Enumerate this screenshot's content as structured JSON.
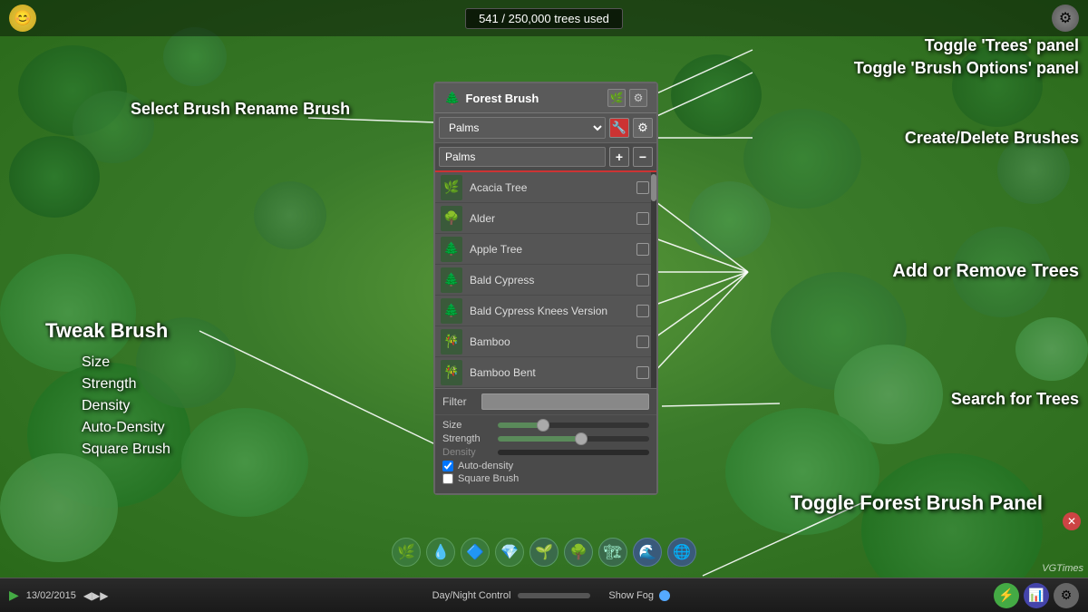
{
  "game": {
    "bg_color": "#3a7a2a",
    "tree_counter": "541 / 250,000 trees used"
  },
  "panel": {
    "title": "Forest Brush",
    "tree_icon": "🌲",
    "settings_icon": "⚙",
    "select_brush_label": "Select Brush",
    "rename_brush_label": "Rename Brush",
    "selected_brush": "Palms",
    "rename_value": "Palms",
    "add_btn": "+",
    "delete_btn": "−",
    "filter_label": "Filter",
    "filter_placeholder": "",
    "tree_list": [
      {
        "name": "Acacia Tree",
        "icon": "🌿",
        "checked": false
      },
      {
        "name": "Alder",
        "icon": "🌳",
        "checked": false
      },
      {
        "name": "Apple Tree",
        "icon": "🌲",
        "checked": false
      },
      {
        "name": "Bald Cypress",
        "icon": "🌲",
        "checked": false
      },
      {
        "name": "Bald Cypress Knees Version",
        "icon": "🌲",
        "checked": false
      },
      {
        "name": "Bamboo",
        "icon": "🎋",
        "checked": false
      },
      {
        "name": "Bamboo Bent",
        "icon": "🎋",
        "checked": false
      }
    ],
    "size_label": "Size",
    "strength_label": "Strength",
    "density_label": "Density",
    "auto_density_label": "Auto-density",
    "square_brush_label": "Square Brush",
    "size_pct": 30,
    "strength_pct": 55,
    "auto_density_checked": true,
    "square_brush_checked": false
  },
  "annotations": {
    "select_brush": "Select Brush\nRename Brush",
    "tweak_brush": "Tweak Brush",
    "tweak_details": "Size\nStrength\nDensity\nAuto-Density\nSquare Brush",
    "toggle_trees": "Toggle 'Trees' panel",
    "toggle_brush_options": "Toggle 'Brush Options' panel",
    "create_delete": "Create/Delete Brushes",
    "add_remove_trees": "Add or Remove Trees",
    "search_trees": "Search for Trees",
    "toggle_panel": "Toggle Forest Brush Panel"
  },
  "taskbar": {
    "date": "13/02/2015",
    "play_icon": "▶",
    "skip_icons": "◀▶▶",
    "day_night": "Day/Night Control",
    "show_fog": "Show Fog",
    "vgtimes": "VGTimes"
  },
  "toolbar_icons": [
    "🌿",
    "💧",
    "⛰",
    "💎",
    "🌱",
    "🌳",
    "🏗",
    "🌊",
    "🌐"
  ]
}
